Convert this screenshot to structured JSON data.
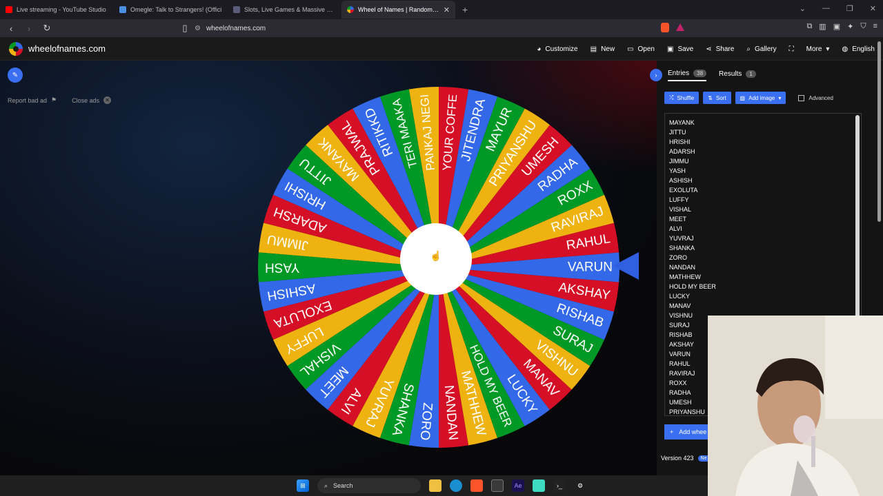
{
  "browser": {
    "tabs": [
      {
        "title": "Live streaming - YouTube Studio",
        "color": "#ff0000"
      },
      {
        "title": "Omegle: Talk to Strangers! (Offici",
        "color": "#4a90e2"
      },
      {
        "title": "Slots, Live Games & Massive Jackpot",
        "color": "#5a5a7a"
      },
      {
        "title": "Wheel of Names | Random nam",
        "color": "#3b6ff2"
      }
    ],
    "new_tab": "+",
    "url": "wheelofnames.com"
  },
  "site": {
    "name": "wheelofnames.com",
    "menu": [
      {
        "label": "Customize",
        "icon": "palette-icon"
      },
      {
        "label": "New",
        "icon": "file-icon"
      },
      {
        "label": "Open",
        "icon": "folder-icon"
      },
      {
        "label": "Save",
        "icon": "save-icon"
      },
      {
        "label": "Share",
        "icon": "share-icon"
      },
      {
        "label": "Gallery",
        "icon": "search-icon"
      },
      {
        "label": "",
        "icon": "fullscreen-icon"
      },
      {
        "label": "More",
        "icon": "chevron-down-icon"
      },
      {
        "label": "English",
        "icon": "globe-icon"
      }
    ]
  },
  "ads": {
    "report": "Report bad ad",
    "close": "Close ads"
  },
  "wheel": {
    "slices": [
      "VARUN",
      "RAHUL",
      "RAVIRAJ",
      "ROXX",
      "RADHA",
      "UMESH",
      "PRIYANSHU",
      "MAYUR",
      "JITENDRA",
      "YOUR COFFE",
      "PANKAJ NEGI",
      "TERI MAAKA",
      "RITIKKD",
      "PRAJWAL",
      "MAYANK",
      "JITTU",
      "HRISHI",
      "ADARSH",
      "JIMMU",
      "YASH",
      "ASHISH",
      "EXOLUTA",
      "LUFFY",
      "VISHAL",
      "MEET",
      "ALVI",
      "YUVRAJ",
      "SHANKA",
      "ZORO",
      "NANDAN",
      "MATHHEW",
      "HOLD MY BEER",
      "LUCKY",
      "MANAV",
      "VISHNU",
      "SURAJ",
      "RISHAB",
      "AKSHAY"
    ],
    "colors": [
      "#3369e8",
      "#d50f25",
      "#eeb211",
      "#009925"
    ]
  },
  "panel": {
    "entries_tab": "Entries",
    "entries_count": "38",
    "results_tab": "Results",
    "results_count": "1",
    "shuffle": "Shuffle",
    "sort": "Sort",
    "add_image": "Add image",
    "advanced": "Advanced",
    "entries": [
      "MAYANK",
      "JITTU",
      "HRISHI",
      "ADARSH",
      "JIMMU",
      "YASH",
      "ASHISH",
      "EXOLUTA",
      "LUFFY",
      "VISHAL",
      "MEET",
      "ALVI",
      "YUVRAJ",
      "SHANKA",
      "ZORO",
      "NANDAN",
      "MATHHEW",
      "HOLD MY BEER",
      "LUCKY",
      "MANAV",
      "VISHNU",
      "SURAJ",
      "RISHAB",
      "AKSHAY",
      "VARUN",
      "RAHUL",
      "RAVIRAJ",
      "ROXX",
      "RADHA",
      "UMESH",
      "PRIYANSHU"
    ],
    "add_wheel": "Add whee",
    "version": "Version 423",
    "new_badge": "Ne"
  },
  "taskbar": {
    "search": "Search"
  }
}
